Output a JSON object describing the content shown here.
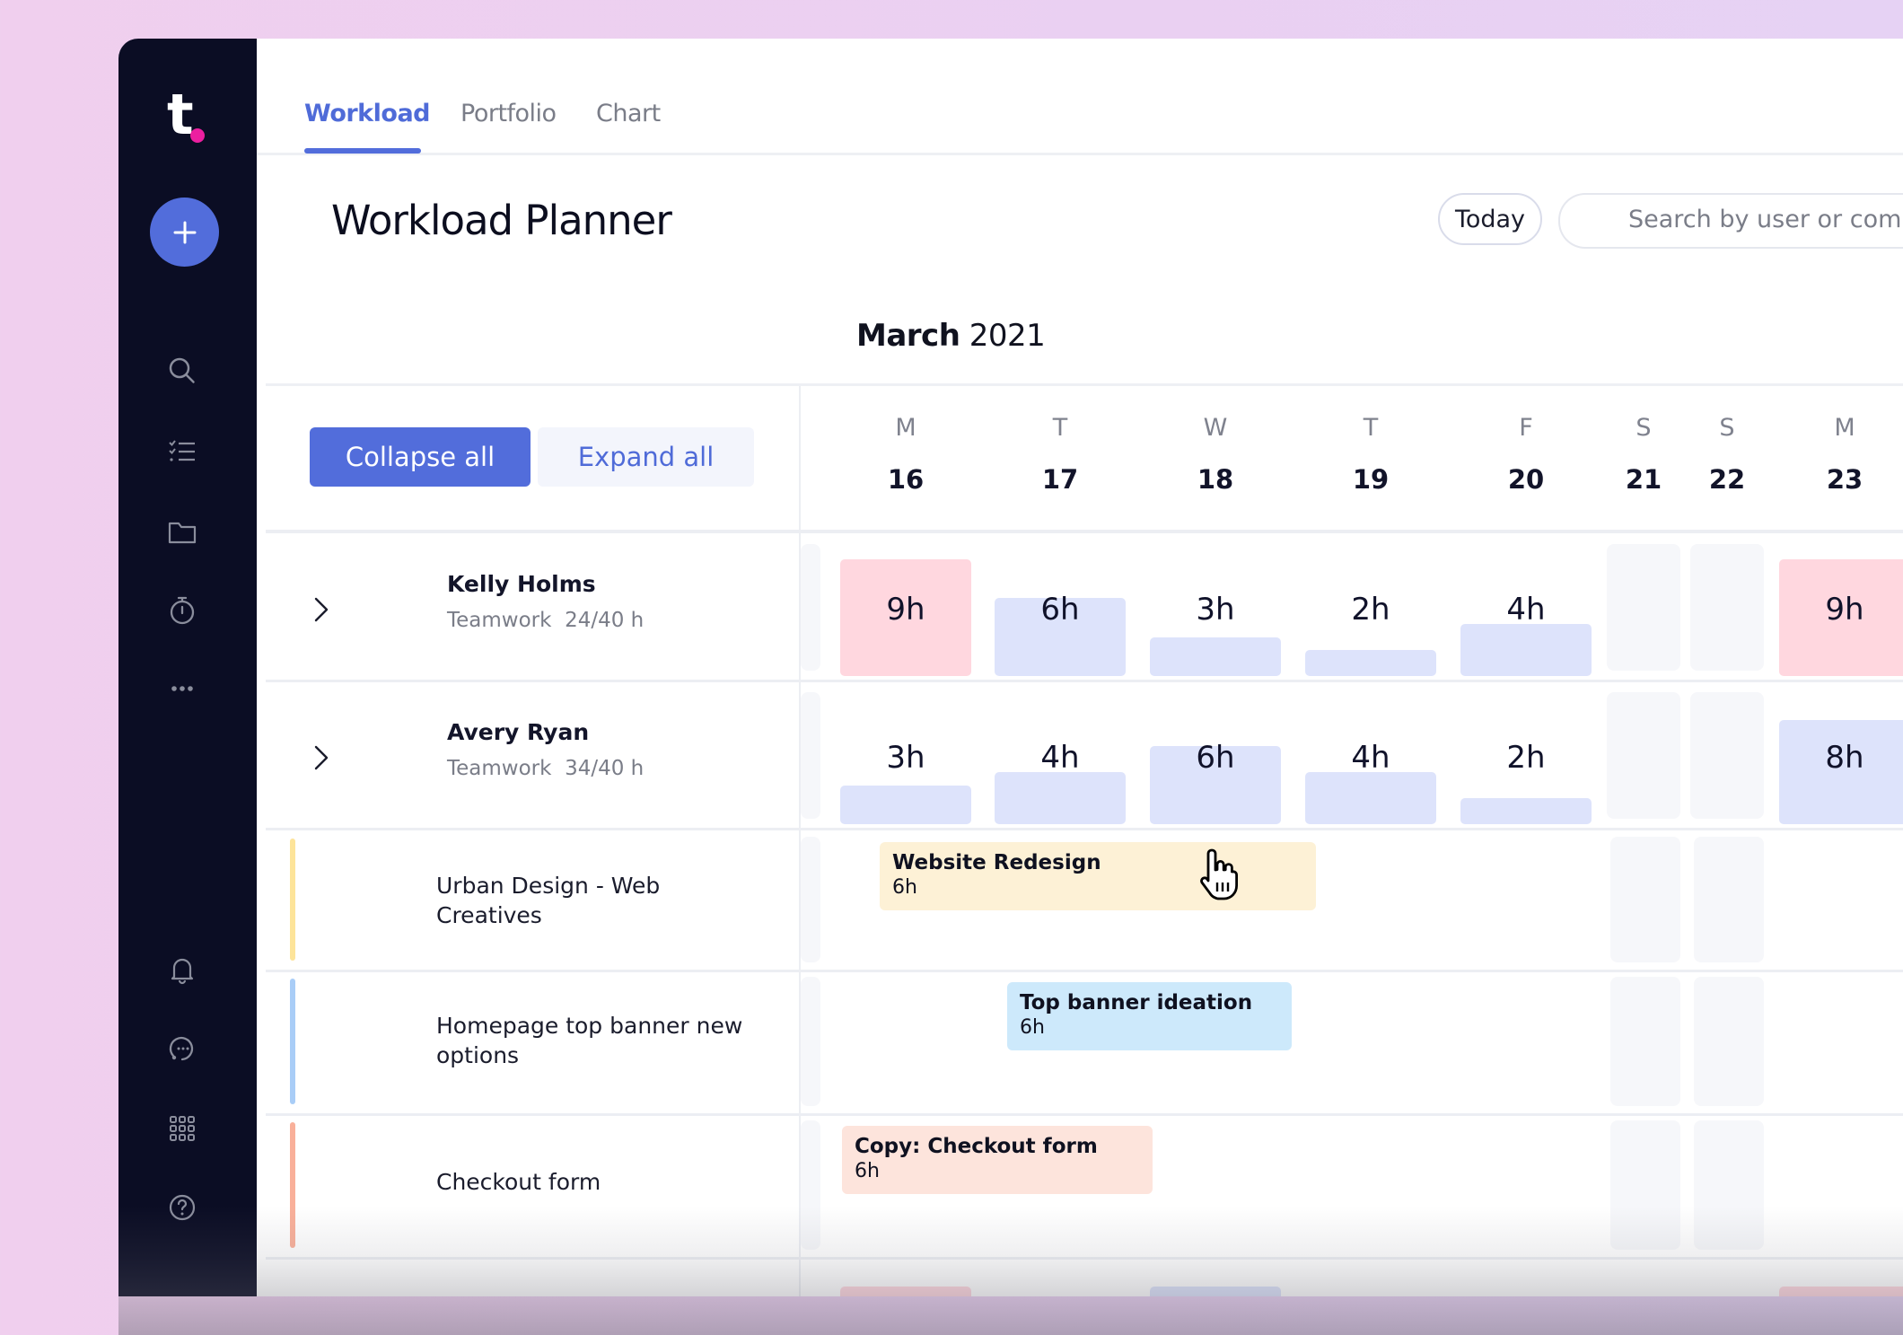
{
  "app": {
    "logo_text": "t",
    "brand_dot_color": "#ec1fa0",
    "accent_color": "#526ddb"
  },
  "sidebar": {
    "add_button_label": "+",
    "top_items": [
      {
        "icon": "search-icon",
        "label": "Search"
      },
      {
        "icon": "checklist-icon",
        "label": "Tasks"
      },
      {
        "icon": "folder-icon",
        "label": "Projects"
      },
      {
        "icon": "stopwatch-icon",
        "label": "Time tracking"
      },
      {
        "icon": "more-icon",
        "label": "More"
      }
    ],
    "bottom_items": [
      {
        "icon": "bell-icon",
        "label": "Notifications"
      },
      {
        "icon": "chat-icon",
        "label": "Chat"
      },
      {
        "icon": "apps-grid-icon",
        "label": "Apps"
      },
      {
        "icon": "help-icon",
        "label": "Help"
      }
    ]
  },
  "tabs": [
    {
      "label": "Workload",
      "active": true
    },
    {
      "label": "Portfolio",
      "active": false
    },
    {
      "label": "Chart",
      "active": false
    }
  ],
  "header": {
    "title": "Workload Planner",
    "today_label": "Today",
    "search_placeholder": "Search by user or company"
  },
  "calendar": {
    "month": "March",
    "year": "2021",
    "collapse_all_label": "Collapse all",
    "expand_all_label": "Expand all",
    "days": [
      {
        "dow": "M",
        "date": "16"
      },
      {
        "dow": "T",
        "date": "17"
      },
      {
        "dow": "W",
        "date": "18"
      },
      {
        "dow": "T",
        "date": "19"
      },
      {
        "dow": "F",
        "date": "20"
      },
      {
        "dow": "S",
        "date": "21",
        "weekend": true
      },
      {
        "dow": "S",
        "date": "22",
        "weekend": true
      },
      {
        "dow": "M",
        "date": "23"
      }
    ]
  },
  "people": [
    {
      "name": "Kelly Holms",
      "company": "Teamwork",
      "capacity": "24/40 h",
      "hours": [
        {
          "label": "9h",
          "value": 9,
          "over": true
        },
        {
          "label": "6h",
          "value": 6,
          "over": false
        },
        {
          "label": "3h",
          "value": 3,
          "over": false
        },
        {
          "label": "2h",
          "value": 2,
          "over": false
        },
        {
          "label": "4h",
          "value": 4,
          "over": false
        },
        null,
        null,
        {
          "label": "9h",
          "value": 9,
          "over": true
        }
      ]
    },
    {
      "name": "Avery Ryan",
      "company": "Teamwork",
      "capacity": "34/40 h",
      "hours": [
        {
          "label": "3h",
          "value": 3,
          "over": false
        },
        {
          "label": "4h",
          "value": 4,
          "over": false
        },
        {
          "label": "6h",
          "value": 6,
          "over": false
        },
        {
          "label": "4h",
          "value": 4,
          "over": false
        },
        {
          "label": "2h",
          "value": 2,
          "over": false
        },
        null,
        null,
        {
          "label": "8h",
          "value": 8,
          "over": false
        }
      ]
    }
  ],
  "projects": [
    {
      "name": "Urban Design - Web Creatives",
      "stripe_color": "#fde49a",
      "task": {
        "title": "Website Redesign",
        "hours": "6h",
        "color": "#fdf1d6"
      }
    },
    {
      "name": "Homepage top banner new options",
      "stripe_color": "#a9cdf7",
      "task": {
        "title": "Top banner ideation",
        "hours": "6h",
        "color": "#cde9fb"
      }
    },
    {
      "name": "Checkout form",
      "stripe_color": "#f9b09a",
      "task": {
        "title": "Copy: Checkout form",
        "hours": "6h",
        "color": "#fde4dc"
      }
    }
  ],
  "colors": {
    "bar_normal": "#dde3fb",
    "bar_over": "#ffd7df"
  }
}
